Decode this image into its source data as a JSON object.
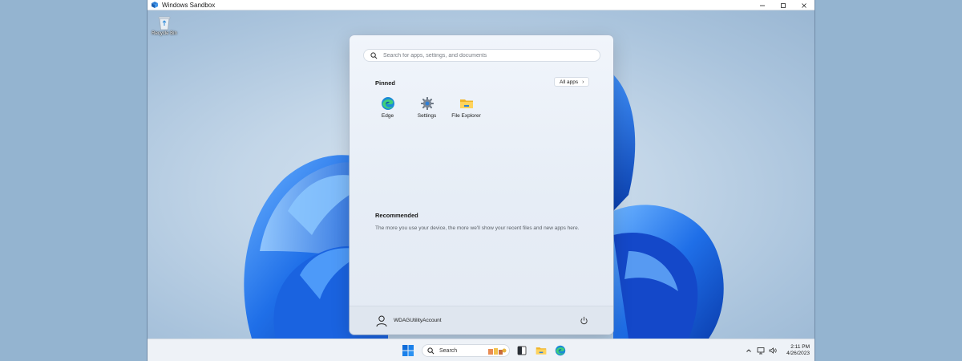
{
  "window": {
    "title": "Windows Sandbox"
  },
  "desktop": {
    "recycle_bin_label": "Recycle Bin"
  },
  "start_menu": {
    "search_placeholder": "Search for apps, settings, and documents",
    "pinned_title": "Pinned",
    "all_apps_label": "All apps",
    "pinned_apps": [
      {
        "name": "Edge",
        "icon": "edge-icon"
      },
      {
        "name": "Settings",
        "icon": "gear-icon"
      },
      {
        "name": "File Explorer",
        "icon": "folder-icon"
      }
    ],
    "recommended_title": "Recommended",
    "recommended_text": "The more you use your device, the more we'll show your recent files and new apps here.",
    "user_name": "WDAGUtilityAccount"
  },
  "taskbar": {
    "search_label": "Search",
    "time": "2:11 PM",
    "date": "4/26/2023"
  },
  "colors": {
    "accent": "#0f5fd8",
    "taskbar": "#eef2f7",
    "start_bg": "#eef3f9"
  }
}
